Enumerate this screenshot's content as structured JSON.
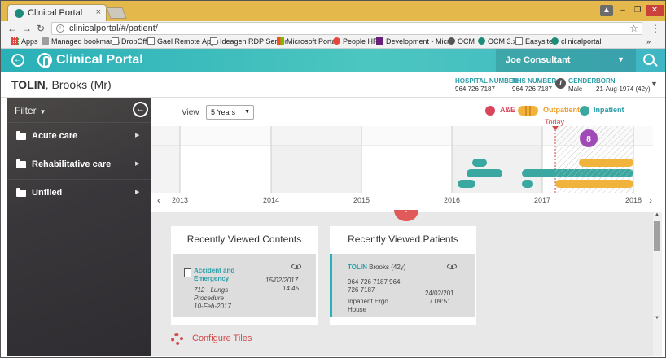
{
  "browser": {
    "tab_title": "Clinical Portal",
    "tab_close": "×",
    "url": "clinicalportal/#/patient/",
    "bookmarks": [
      "Apps",
      "Managed bookmarks",
      "DropOff",
      "Gael Remote Apps",
      "Ideagen RDP Server",
      "Microsoft Portal",
      "People HR",
      "Development - Micro",
      "OCM",
      "OCM 3.x",
      "Easysite",
      "clinicalportal"
    ],
    "more": "»"
  },
  "app": {
    "title": "Clinical Portal",
    "user": "Joe Consultant"
  },
  "patient": {
    "surname": "TOLIN",
    "given": ", Brooks (Mr)",
    "hospital_number_label": "HOSPITAL NUMBER",
    "hospital_number": "964 726 7187",
    "nhs_number_label": "NHS NUMBER",
    "nhs_number": "964 726 7187",
    "gender_label": "GENDER",
    "gender": "Male",
    "born_label": "BORN",
    "born": "21-Aug-1974 (42y)"
  },
  "sidebar": {
    "filter_label": "Filter",
    "items": [
      {
        "label": "Acute care"
      },
      {
        "label": "Rehabilitative care"
      },
      {
        "label": "Unfiled"
      }
    ]
  },
  "timeline": {
    "view_label": "View",
    "view_value": "5 Years",
    "legend": [
      {
        "label": "A&E",
        "color": "#d9455a"
      },
      {
        "label": "Outpatient",
        "color": "#f0b43c"
      },
      {
        "label": "Inpatient",
        "color": "#3aa8a0"
      }
    ],
    "today_label": "Today",
    "years": [
      "2013",
      "2014",
      "2015",
      "2016",
      "2017",
      "2018"
    ],
    "cluster_count": "8",
    "colors": {
      "accent": "#2ab0b8",
      "cluster": "#a04ab8"
    }
  },
  "tiles": {
    "contents": {
      "title": "Recently Viewed Contents",
      "item_title": "Accident and Emergency",
      "item_detail_1": "712 - Lungs",
      "item_detail_2": "Procedure",
      "item_detail_3": "10-Feb-2017",
      "item_date": "15/02/2017",
      "item_time": "14:45"
    },
    "patients": {
      "title": "Recently Viewed Patients",
      "name": "TOLIN",
      "name_rest": "Brooks (42y)",
      "numbers_1": "964 726 7187     964",
      "numbers_2": "726 7187",
      "location_1": "Inpatient   Ergo",
      "location_2": "House",
      "date_1": "24/02/201",
      "date_2": "7 09:51"
    }
  },
  "configure_label": "Configure Tiles"
}
